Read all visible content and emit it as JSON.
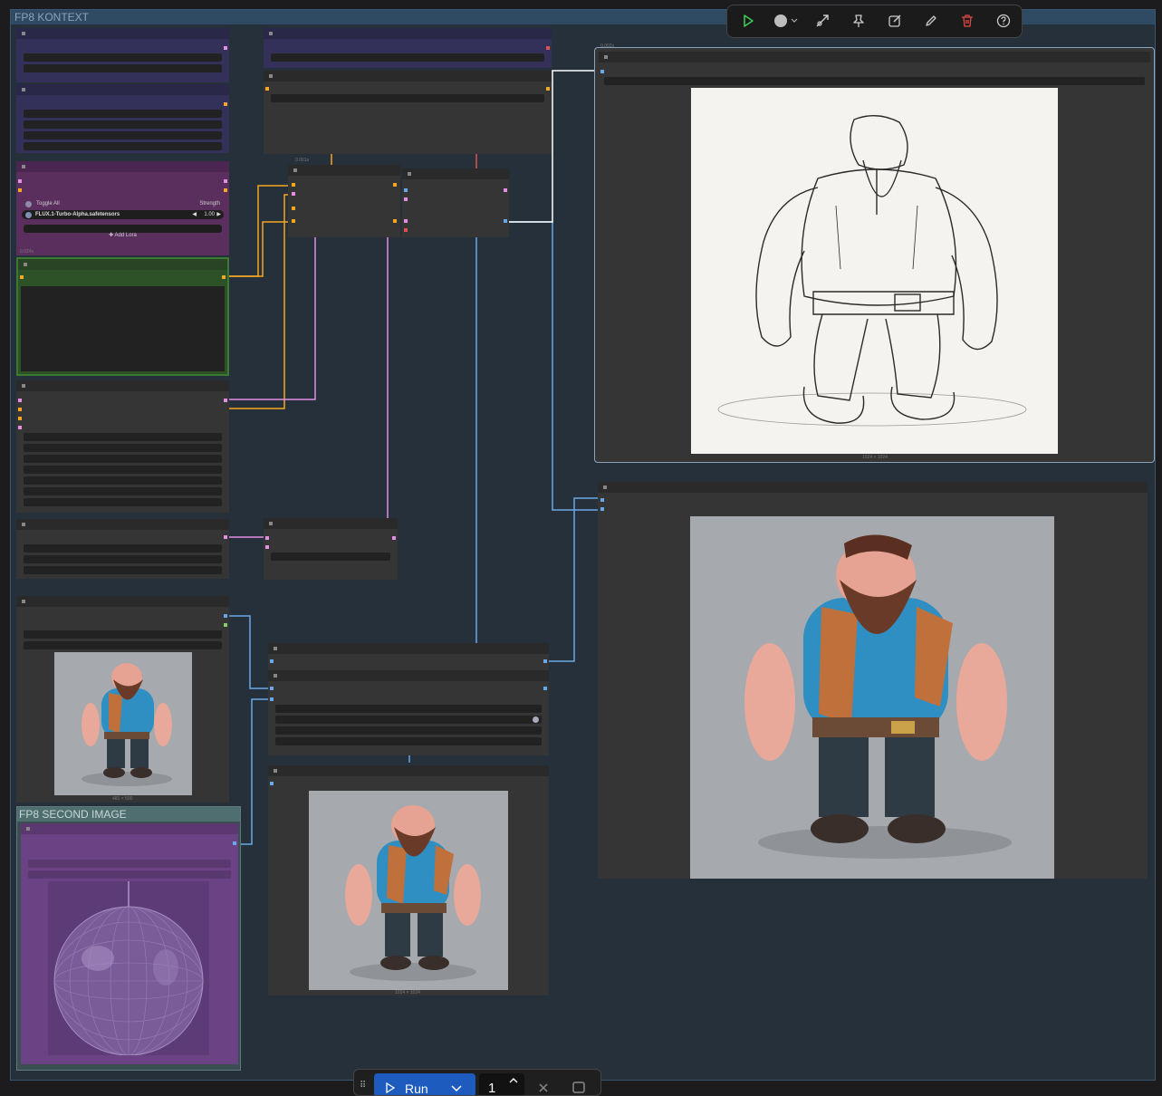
{
  "groups": {
    "main_title": "FP8 KONTEXT",
    "second_title": "FP8 SECOND IMAGE"
  },
  "lora": {
    "toggle_all": "Toggle All",
    "strength_header": "Strength",
    "lora_name": "FLUX.1-Turbo-Alpha.safetensors",
    "strength_value": "1.00",
    "add_lora": "Add Lora"
  },
  "timings": {
    "lora_node": "0.024s",
    "sampler_node": "0.001s",
    "preview_top": "0.002s"
  },
  "image_sizes": {
    "preview_top": "1024 × 1024",
    "load_image": "481 × 500",
    "preview_mid": "1024 × 1024"
  },
  "toolbar": {
    "items": [
      "play-icon",
      "color-picker-icon",
      "bypass-icon",
      "pin-icon",
      "edit-icon",
      "pencil-icon",
      "delete-icon",
      "help-icon"
    ]
  },
  "run_bar": {
    "run_label": "Run",
    "batch_count": "1"
  },
  "colors": {
    "canvas": "#26303a",
    "group_border": "#4a6a86",
    "wire_orange": "#f5a623",
    "wire_pink": "#e48ee4",
    "wire_blue": "#6aa7e8",
    "wire_white": "#ffffff",
    "run_blue": "#1d5bbf"
  }
}
